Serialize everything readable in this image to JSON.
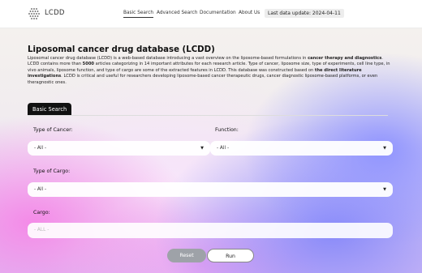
{
  "header": {
    "brand": "LCDD",
    "nav": [
      {
        "label": "Basic Search",
        "active": true
      },
      {
        "label": "Advanced Search",
        "active": false
      },
      {
        "label": "Documentation",
        "active": false
      },
      {
        "label": "About Us",
        "active": false
      }
    ],
    "last_update": "Last data update: 2024-04-11"
  },
  "main": {
    "title": "Liposomal cancer drug database (LCDD)",
    "description": {
      "p1": "Liposomal cancer drug database (LCDD) is a web-based database introducing a vast overview on the liposome-based formulations in ",
      "b1": "cancer therapy and diagnostics",
      "p2": ". LCDD contains more than ",
      "b2": "5000",
      "p3": " articles categorizing in 14 important attributes for each research article. Type of cancer, liposome size, type of experiments, cell line type, in vivo animals, liposome function, and type of cargo are some of the extracted features in LCDD. This database was constructed based on ",
      "b3": "the direct literature investigations",
      "p4": ". LCDD is critical and useful for researchers developing liposome-based cancer therapeutic drugs, cancer diagnostic liposome-based platforms, or even theragnostic ones."
    },
    "tab_label": "Basic Search",
    "form": {
      "cancer_label": "Type of Cancer:",
      "cancer_value": "- All -",
      "function_label": "Function:",
      "function_value": "- All -",
      "cargo_type_label": "Type of Cargo:",
      "cargo_type_value": "- All -",
      "cargo_label": "Cargo:",
      "cargo_placeholder": "- ALL -",
      "reset_label": "Reset",
      "run_label": "Run"
    }
  },
  "colors": {
    "accent_dark": "#111111",
    "gradient_violet": "#8c91ff",
    "gradient_pink": "#f582e6"
  },
  "icons": {
    "logo": "dot-grid-hexagon-icon",
    "caret": "caret-down-icon"
  }
}
